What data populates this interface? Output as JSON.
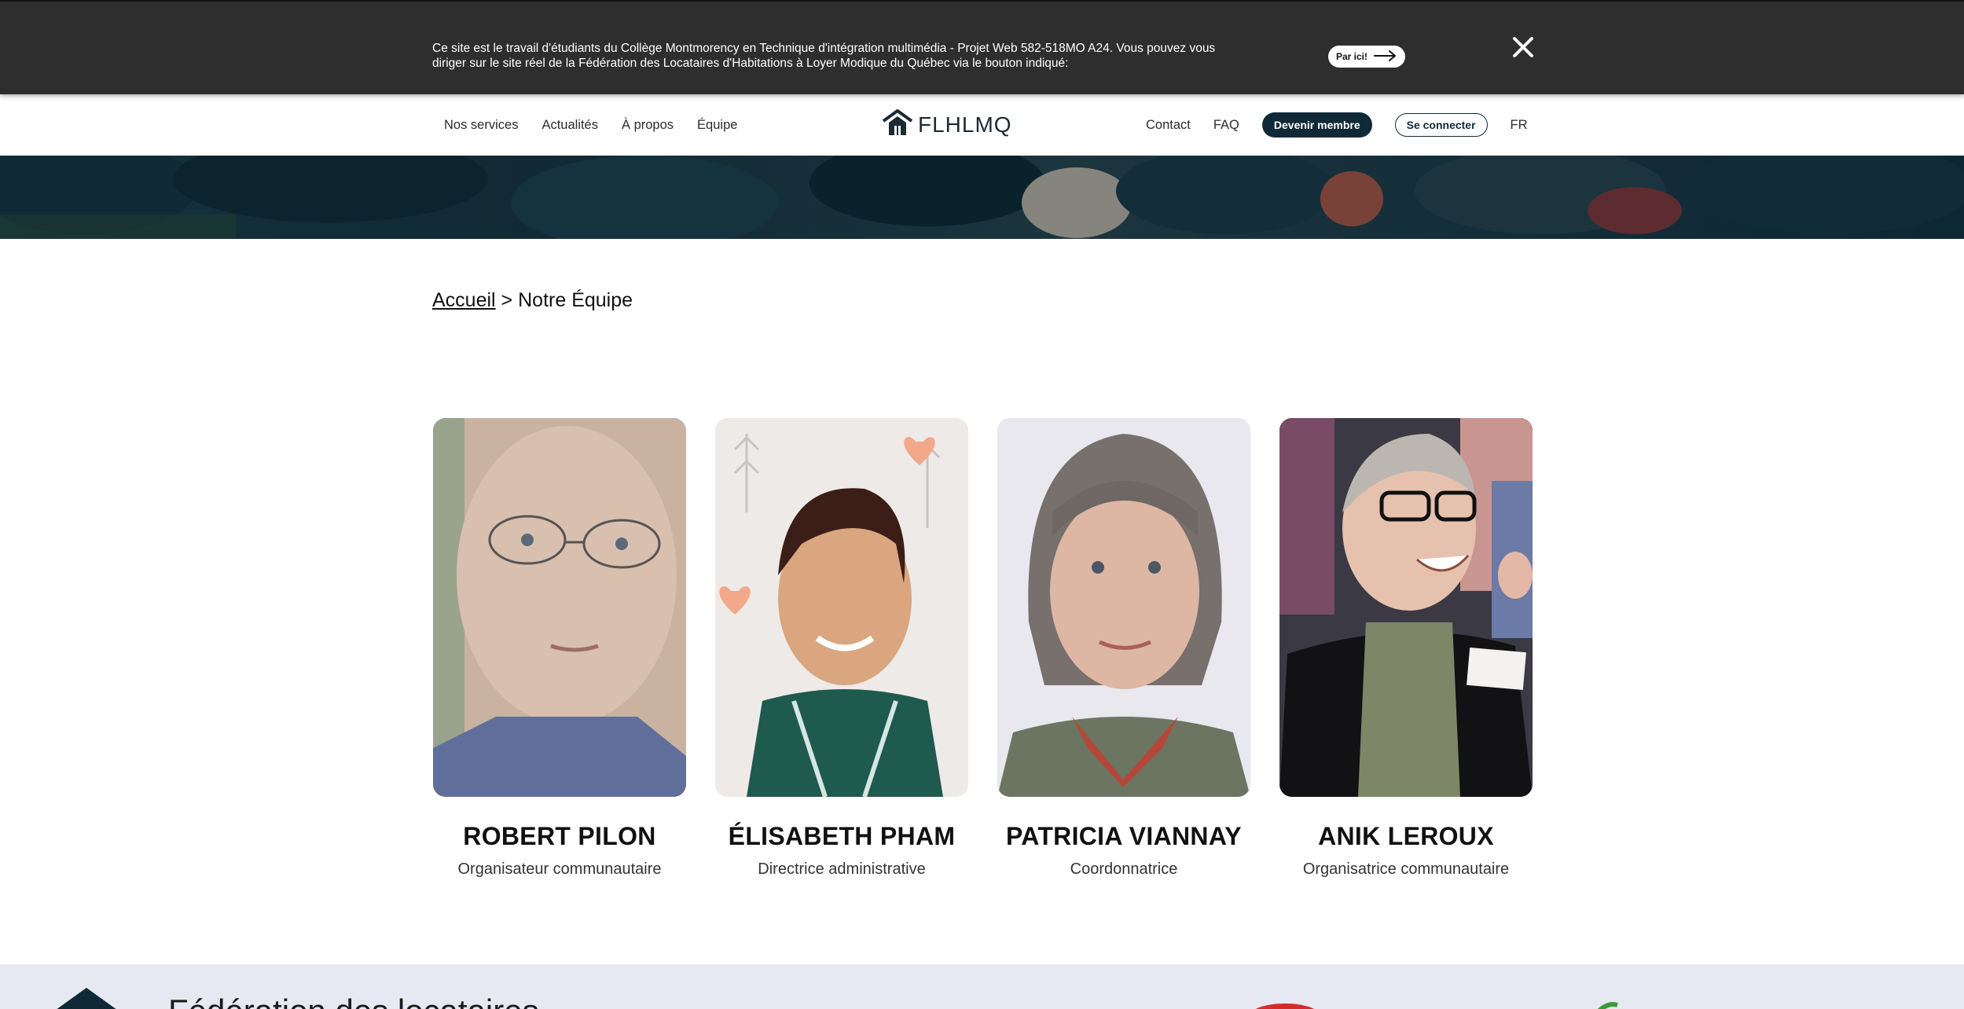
{
  "notice": {
    "text": "Ce site est le travail d'étudiants du Collège Montmorency en Technique d'intégration multimédia - Projet Web 582-518MO A24. Vous pouvez vous diriger sur le site réel de la Fédération des Locataires d'Habitations à Loyer Modique du Québec via le bouton indiqué:",
    "button_label": "Par ici!",
    "button_icon": "arrow-right-icon",
    "close_icon": "close-icon"
  },
  "nav": {
    "left_links": [
      "Nos services",
      "Actualités",
      "À propos",
      "Équipe"
    ],
    "logo_text": "FLHLMQ",
    "contact": "Contact",
    "faq": "FAQ",
    "become_member": "Devenir membre",
    "login": "Se connecter",
    "lang": "FR"
  },
  "breadcrumb": {
    "home": "Accueil",
    "separator": ">",
    "current": "Notre Équipe"
  },
  "team": [
    {
      "name": "ROBERT PILON",
      "role": "Organisateur communautaire"
    },
    {
      "name": "ÉLISABETH PHAM",
      "role": "Directrice administrative"
    },
    {
      "name": "PATRICIA VIANNAY",
      "role": "Coordonnatrice"
    },
    {
      "name": "ANIK LEROUX",
      "role": "Organisatrice communautaire"
    }
  ],
  "footer": {
    "title": "Fédération des locataires"
  },
  "colors": {
    "banner_bg": "#2e2e2e",
    "primary": "#0f2a36",
    "footer_bg": "#e6e9f2"
  }
}
